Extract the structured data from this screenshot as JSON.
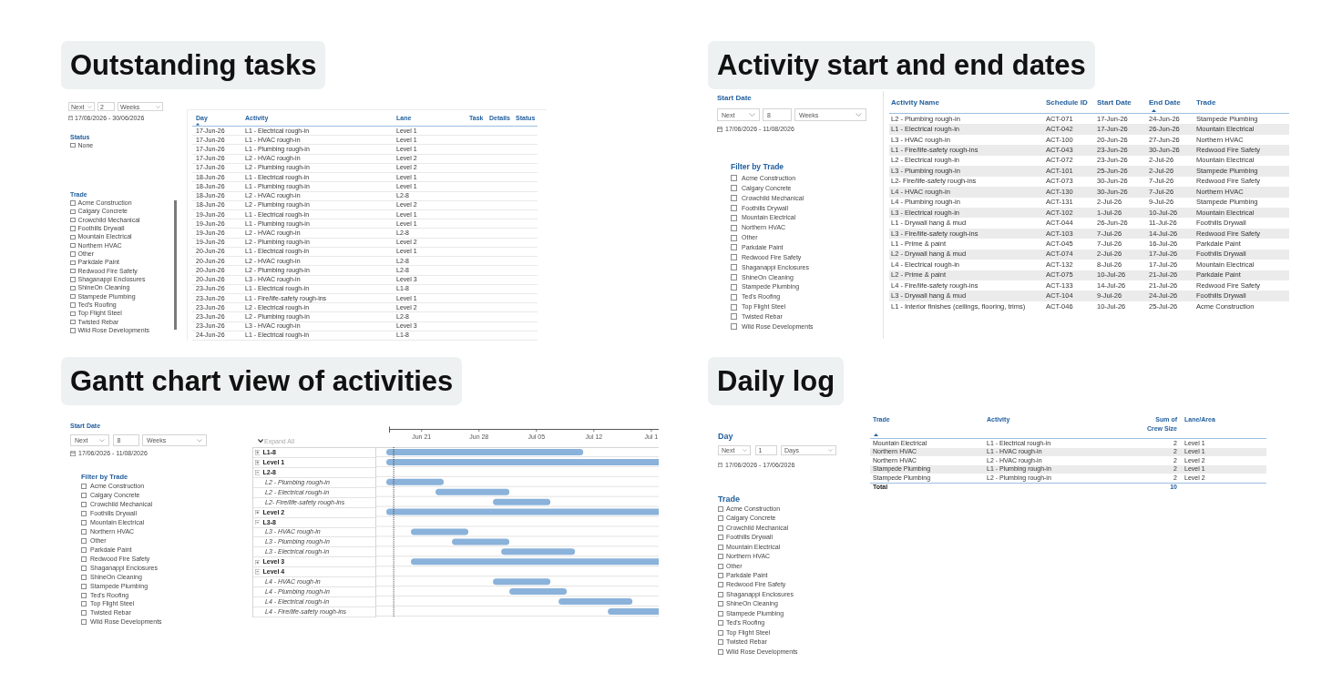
{
  "outstanding_tasks": {
    "title": "Outstanding tasks",
    "date_filter": {
      "mode": "Next",
      "count": "2",
      "unit": "Weeks",
      "range": "17/06/2026 - 30/06/2026"
    },
    "filters": [
      {
        "title": "Status",
        "options": [
          {
            "label": "None",
            "checked": false
          }
        ]
      },
      {
        "title": "Trade",
        "options": [
          {
            "label": "Acme Construction",
            "checked": false
          },
          {
            "label": "Calgary Concrete",
            "checked": false
          },
          {
            "label": "Crowchild Mechanical",
            "checked": false
          },
          {
            "label": "Foothills Drywall",
            "checked": false
          },
          {
            "label": "Mountain Electrical",
            "checked": false
          },
          {
            "label": "Northern HVAC",
            "checked": false
          },
          {
            "label": "Other",
            "checked": false
          },
          {
            "label": "Parkdale Paint",
            "checked": false
          },
          {
            "label": "Redwood Fire Safety",
            "checked": false
          },
          {
            "label": "Shaganappi Enclosures",
            "checked": false
          },
          {
            "label": "ShineOn Cleaning",
            "checked": false
          },
          {
            "label": "Stampede Plumbing",
            "checked": false
          },
          {
            "label": "Ted's Roofing",
            "checked": false
          },
          {
            "label": "Top Flight Steel",
            "checked": false
          },
          {
            "label": "Twisted Rebar",
            "checked": false
          },
          {
            "label": "Wild Rose Developments",
            "checked": false
          }
        ]
      }
    ],
    "table": {
      "columns": [
        {
          "label": "Day",
          "sorted": true
        },
        {
          "label": "Activity",
          "sorted": false
        },
        {
          "label": "Lane",
          "sorted": false
        },
        {
          "label": "Task",
          "sorted": false
        },
        {
          "label": "Details",
          "sorted": false
        },
        {
          "label": "Status",
          "sorted": false
        }
      ],
      "rows": [
        [
          "17-Jun-26",
          "L1 - Electrical rough-in",
          "Level 1"
        ],
        [
          "17-Jun-26",
          "L1 - HVAC rough-in",
          "Level 1"
        ],
        [
          "17-Jun-26",
          "L1 - Plumbing rough-in",
          "Level 1"
        ],
        [
          "17-Jun-26",
          "L2 - HVAC rough-in",
          "Level 2"
        ],
        [
          "17-Jun-26",
          "L2 - Plumbing rough-in",
          "Level 2"
        ],
        [
          "18-Jun-26",
          "L1 - Electrical rough-in",
          "Level 1"
        ],
        [
          "18-Jun-26",
          "L1 - Plumbing rough-in",
          "Level 1"
        ],
        [
          "18-Jun-26",
          "L2 - HVAC rough-in",
          "L2-8"
        ],
        [
          "18-Jun-26",
          "L2 - Plumbing rough-in",
          "Level 2"
        ],
        [
          "19-Jun-26",
          "L1 - Electrical rough-in",
          "Level 1"
        ],
        [
          "19-Jun-26",
          "L1 - Plumbing rough-in",
          "Level 1"
        ],
        [
          "19-Jun-26",
          "L2 - HVAC rough-in",
          "L2-8"
        ],
        [
          "19-Jun-26",
          "L2 - Plumbing rough-in",
          "Level 2"
        ],
        [
          "20-Jun-26",
          "L1 - Electrical rough-in",
          "Level 1"
        ],
        [
          "20-Jun-26",
          "L2 - HVAC rough-in",
          "L2-8"
        ],
        [
          "20-Jun-26",
          "L2 - Plumbing rough-in",
          "L2-8"
        ],
        [
          "20-Jun-26",
          "L3 - HVAC rough-in",
          "Level 3"
        ],
        [
          "23-Jun-26",
          "L1 - Electrical rough-in",
          "L1-8"
        ],
        [
          "23-Jun-26",
          "L1 - Fire/life-safety rough-ins",
          "Level 1"
        ],
        [
          "23-Jun-26",
          "L2 - Electrical rough-in",
          "Level 2"
        ],
        [
          "23-Jun-26",
          "L2 - Plumbing rough-in",
          "L2-8"
        ],
        [
          "23-Jun-26",
          "L3 - HVAC rough-in",
          "Level 3"
        ],
        [
          "24-Jun-26",
          "L1 - Electrical rough-in",
          "L1-8"
        ]
      ]
    }
  },
  "activity_dates": {
    "title": "Activity start and end dates",
    "date_filter": {
      "label": "Start Date",
      "mode": "Next",
      "count": "8",
      "unit": "Weeks",
      "range": "17/06/2026 - 11/08/2026"
    },
    "filters": [
      {
        "title": "Filter by Trade",
        "options": [
          {
            "label": "Acme Construction",
            "checked": false
          },
          {
            "label": "Calgary Concrete",
            "checked": false
          },
          {
            "label": "Crowchild Mechanical",
            "checked": false
          },
          {
            "label": "Foothills Drywall",
            "checked": false
          },
          {
            "label": "Mountain Electrical",
            "checked": false
          },
          {
            "label": "Northern HVAC",
            "checked": false
          },
          {
            "label": "Other",
            "checked": false
          },
          {
            "label": "Parkdale Paint",
            "checked": false
          },
          {
            "label": "Redwood Fire Safety",
            "checked": false
          },
          {
            "label": "Shaganappi Enclosures",
            "checked": false
          },
          {
            "label": "ShineOn Cleaning",
            "checked": false
          },
          {
            "label": "Stampede Plumbing",
            "checked": false
          },
          {
            "label": "Ted's Roofing",
            "checked": false
          },
          {
            "label": "Top Flight Steel",
            "checked": false
          },
          {
            "label": "Twisted Rebar",
            "checked": false
          },
          {
            "label": "Wild Rose Developments",
            "checked": false
          }
        ]
      }
    ],
    "table": {
      "columns": [
        {
          "label": "Activity Name",
          "sorted": false
        },
        {
          "label": "Schedule ID",
          "sorted": false
        },
        {
          "label": "Start Date",
          "sorted": false
        },
        {
          "label": "End Date",
          "sorted": true
        },
        {
          "label": "Trade",
          "sorted": false
        }
      ],
      "rows": [
        [
          "L2 - Plumbing rough-in",
          "ACT-071",
          "17-Jun-26",
          "24-Jun-26",
          "Stampede Plumbing"
        ],
        [
          "L1 - Electrical rough-in",
          "ACT-042",
          "17-Jun-26",
          "26-Jun-26",
          "Mountain Electrical"
        ],
        [
          "L3 - HVAC rough-in",
          "ACT-100",
          "20-Jun-26",
          "27-Jun-26",
          "Northern HVAC"
        ],
        [
          "L1 - Fire/life-safety rough-ins",
          "ACT-043",
          "23-Jun-26",
          "30-Jun-26",
          "Redwood Fire Safety"
        ],
        [
          "L2 - Electrical rough-in",
          "ACT-072",
          "23-Jun-26",
          "2-Jul-26",
          "Mountain Electrical"
        ],
        [
          "L3 - Plumbing rough-in",
          "ACT-101",
          "25-Jun-26",
          "2-Jul-26",
          "Stampede Plumbing"
        ],
        [
          "L2- Fire/life-safety rough-ins",
          "ACT-073",
          "30-Jun-26",
          "7-Jul-26",
          "Redwood Fire Safety"
        ],
        [
          "L4 - HVAC rough-in",
          "ACT-130",
          "30-Jun-26",
          "7-Jul-26",
          "Northern HVAC"
        ],
        [
          "L4 - Plumbing rough-in",
          "ACT-131",
          "2-Jul-26",
          "9-Jul-26",
          "Stampede Plumbing"
        ],
        [
          "L3 - Electrical rough-in",
          "ACT-102",
          "1-Jul-26",
          "10-Jul-26",
          "Mountain Electrical"
        ],
        [
          "L1 - Drywall hang & mud",
          "ACT-044",
          "26-Jun-26",
          "11-Jul-26",
          "Foothills Drywall"
        ],
        [
          "L3 - Fire/life-safety rough-ins",
          "ACT-103",
          "7-Jul-26",
          "14-Jul-26",
          "Redwood Fire Safety"
        ],
        [
          "L1 - Prime & paint",
          "ACT-045",
          "7-Jul-26",
          "16-Jul-26",
          "Parkdale Paint"
        ],
        [
          "L2 - Drywall hang & mud",
          "ACT-074",
          "2-Jul-26",
          "17-Jul-26",
          "Foothills Drywall"
        ],
        [
          "L4 - Electrical rough-in",
          "ACT-132",
          "8-Jul-26",
          "17-Jul-26",
          "Mountain Electrical"
        ],
        [
          "L2 - Prime & paint",
          "ACT-075",
          "10-Jul-26",
          "21-Jul-26",
          "Parkdale Paint"
        ],
        [
          "L4 - Fire/life-safety rough-ins",
          "ACT-133",
          "14-Jul-26",
          "21-Jul-26",
          "Redwood Fire Safety"
        ],
        [
          "L3 - Drywall hang & mud",
          "ACT-104",
          "9-Jul-26",
          "24-Jul-26",
          "Foothills Drywall"
        ],
        [
          "L1 - Interior finishes (ceilings, flooring, trims)",
          "ACT-046",
          "10-Jul-26",
          "25-Jul-26",
          "Acme Construction"
        ]
      ]
    }
  },
  "gantt_view": {
    "title": "Gantt chart view of activities",
    "date_filter": {
      "label": "Start Date",
      "mode": "Next",
      "count": "8",
      "unit": "Weeks",
      "range": "17/06/2026 - 11/08/2026"
    },
    "filters": [
      {
        "title": "Filter by Trade",
        "options": [
          {
            "label": "Acme Construction",
            "checked": false
          },
          {
            "label": "Calgary Concrete",
            "checked": false
          },
          {
            "label": "Crowchild Mechanical",
            "checked": false
          },
          {
            "label": "Foothills Drywall",
            "checked": false
          },
          {
            "label": "Mountain Electrical",
            "checked": false
          },
          {
            "label": "Northern HVAC",
            "checked": false
          },
          {
            "label": "Other",
            "checked": false
          },
          {
            "label": "Parkdale Paint",
            "checked": false
          },
          {
            "label": "Redwood Fire Safety",
            "checked": false
          },
          {
            "label": "Shaganappi Enclosures",
            "checked": false
          },
          {
            "label": "ShineOn Cleaning",
            "checked": false
          },
          {
            "label": "Stampede Plumbing",
            "checked": false
          },
          {
            "label": "Ted's Roofing",
            "checked": false
          },
          {
            "label": "Top Flight Steel",
            "checked": false
          },
          {
            "label": "Twisted Rebar",
            "checked": false
          },
          {
            "label": "Wild Rose Developments",
            "checked": false
          }
        ]
      }
    ],
    "gantt": {
      "expand_all": "Expand All",
      "timeline": [
        "Jun 21",
        "Jun 28",
        "Jul 05",
        "Jul 12",
        "Jul 1"
      ],
      "rows": [
        {
          "kind": "group",
          "label": "L1-8",
          "expanded": false
        },
        {
          "kind": "group",
          "label": "Level 1",
          "expanded": false
        },
        {
          "kind": "group",
          "label": "L2-8",
          "expanded": true,
          "children": [
            {
              "kind": "activity",
              "label": "L2 - Plumbing rough-in"
            },
            {
              "kind": "activity",
              "label": "L2 - Electrical rough-in"
            },
            {
              "kind": "activity",
              "label": "L2- Fire/life-safety rough-ins"
            }
          ]
        },
        {
          "kind": "group",
          "label": "Level 2",
          "expanded": false
        },
        {
          "kind": "group",
          "label": "L3-8",
          "expanded": true,
          "children": [
            {
              "kind": "activity",
              "label": "L3 - HVAC rough-in"
            },
            {
              "kind": "activity",
              "label": "L3 - Plumbing rough-in"
            },
            {
              "kind": "activity",
              "label": "L3 - Electrical rough-in"
            }
          ]
        },
        {
          "kind": "group",
          "label": "Level 3",
          "expanded": false
        },
        {
          "kind": "group",
          "label": "Level 4",
          "expanded": true,
          "children": [
            {
              "kind": "activity",
              "label": "L4 - HVAC rough-in"
            },
            {
              "kind": "activity",
              "label": "L4 - Plumbing rough-in"
            },
            {
              "kind": "activity",
              "label": "L4 - Electrical rough-in"
            },
            {
              "kind": "activity",
              "label": "L4 - Fire/life-safety rough-ins"
            }
          ]
        }
      ]
    }
  },
  "daily_log": {
    "title": "Daily log",
    "date_filter": {
      "label": "Day",
      "mode": "Next",
      "count": "1",
      "unit": "Days",
      "range": "17/06/2026 - 17/06/2026"
    },
    "filters": [
      {
        "title": "Trade",
        "options": [
          {
            "label": "Acme Construction",
            "checked": false
          },
          {
            "label": "Calgary Concrete",
            "checked": false
          },
          {
            "label": "Crowchild Mechanical",
            "checked": false
          },
          {
            "label": "Foothills Drywall",
            "checked": false
          },
          {
            "label": "Mountain Electrical",
            "checked": false
          },
          {
            "label": "Northern HVAC",
            "checked": false
          },
          {
            "label": "Other",
            "checked": false
          },
          {
            "label": "Parkdale Paint",
            "checked": false
          },
          {
            "label": "Redwood Fire Safety",
            "checked": false
          },
          {
            "label": "Shaganappi Enclosures",
            "checked": false
          },
          {
            "label": "ShineOn Cleaning",
            "checked": false
          },
          {
            "label": "Stampede Plumbing",
            "checked": false
          },
          {
            "label": "Ted's Roofing",
            "checked": false
          },
          {
            "label": "Top Flight Steel",
            "checked": false
          },
          {
            "label": "Twisted Rebar",
            "checked": false
          },
          {
            "label": "Wild Rose Developments",
            "checked": false
          }
        ]
      }
    ],
    "table": {
      "columns": [
        {
          "label": "Trade",
          "sorted": true
        },
        {
          "label": "Activity",
          "sorted": false
        },
        {
          "label": "Sum of Crew Size",
          "sorted": false
        },
        {
          "label": "Lane/Area",
          "sorted": false
        }
      ],
      "rows": [
        [
          "Mountain Electrical",
          "L1 - Electrical rough-in",
          "2",
          "Level 1"
        ],
        [
          "Northern HVAC",
          "L1 - HVAC rough-in",
          "2",
          "Level 1"
        ],
        [
          "Northern HVAC",
          "L2 - HVAC rough-in",
          "2",
          "Level 2"
        ],
        [
          "Stampede Plumbing",
          "L1 - Plumbing rough-in",
          "2",
          "Level 1"
        ],
        [
          "Stampede Plumbing",
          "L2 - Plumbing rough-in",
          "2",
          "Level 2"
        ]
      ],
      "total": {
        "label": "Total",
        "crew_size": "10"
      }
    }
  }
}
